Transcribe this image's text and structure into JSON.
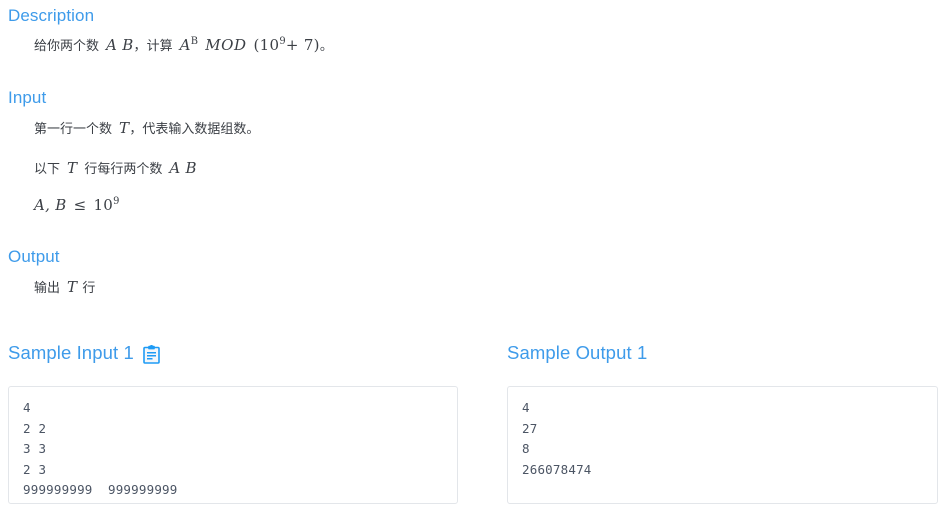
{
  "sections": {
    "description": {
      "heading": "Description",
      "body": {
        "lead_cjk": "给你两个数",
        "math_ab": "A B",
        "comma_cjk": "，",
        "calc_cjk": "计算",
        "math_expr_base": "A",
        "math_expr_exp": "B",
        "math_op": "MOD",
        "math_mod_open": "(10",
        "math_mod_exp": "9",
        "math_mod_rest": "+ 7)",
        "period_cjk": "。"
      }
    },
    "input": {
      "heading": "Input",
      "line1_pre": "第一行一个数",
      "line1_var": "T",
      "line1_post": "，代表输入数据组数。",
      "line2_pre": "以下",
      "line2_var": "T",
      "line2_mid": "行每行两个数",
      "line2_vars": "A B",
      "line3_vars": "A, B",
      "line3_rel": "≤",
      "line3_num": "10",
      "line3_exp": "9"
    },
    "output": {
      "heading": "Output",
      "line1_pre": "输出",
      "line1_var": "T",
      "line1_post": "行"
    }
  },
  "samples": {
    "input": {
      "heading": "Sample Input 1",
      "copy_icon": "clipboard-copy-icon",
      "content": "4\n2 2\n3 3\n2 3\n999999999  999999999"
    },
    "output": {
      "heading": "Sample Output 1",
      "content": "4\n27\n8\n266078474"
    }
  },
  "colors": {
    "heading_blue": "#3e9bea",
    "body_text": "#3b3f45",
    "code_text": "#4c5564",
    "box_border": "#e3e6ea",
    "background": "#ffffff"
  }
}
